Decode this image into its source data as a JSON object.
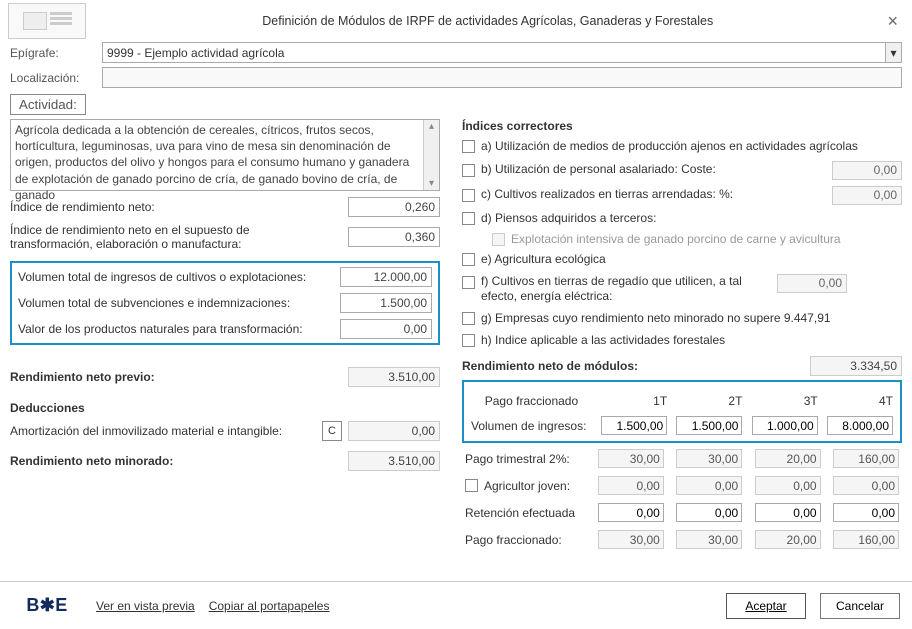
{
  "title": "Definición de Módulos de IRPF de actividades Agrícolas, Ganaderas y Forestales",
  "labels": {
    "epigrafe": "Epígrafe:",
    "localizacion": "Localización:",
    "actividad_btn": "Actividad:"
  },
  "epigrafe_value": "9999 - Ejemplo actividad agrícola",
  "actividad_text": "Agrícola dedicada a la obtención de cereales, cítricos, frutos secos, hortícultura, leguminosas, uva para vino de mesa sin denominación de origen, productos del olivo y hongos para el consumo humano y ganadera de explotación de ganado porcino de cría, de ganado bovino de cría, de ganado",
  "left": {
    "indice_neto_label": "Índice de rendimiento neto:",
    "indice_neto_value": "0,260",
    "indice_transf_label": "Índice de rendimiento neto en el supuesto de transformación, elaboración o manufactura:",
    "indice_transf_value": "0,360",
    "vol_ingresos_label": "Volumen total de ingresos de cultivos o explotaciones:",
    "vol_ingresos_value": "12.000,00",
    "vol_subv_label": "Volumen total de subvenciones e indemnizaciones:",
    "vol_subv_value": "1.500,00",
    "valor_prod_label": "Valor de los productos naturales para transformación:",
    "valor_prod_value": "0,00",
    "rend_previo_label": "Rendimiento neto previo:",
    "rend_previo_value": "3.510,00",
    "deducciones_label": "Deducciones",
    "amort_label": "Amortización del inmovilizado material e intangible:",
    "amort_btn": "C",
    "amort_value": "0,00",
    "rend_minorado_label": "Rendimiento neto minorado:",
    "rend_minorado_value": "3.510,00"
  },
  "right": {
    "indices_head": "Índices correctores",
    "a_label": "a) Utilización de medios de producción ajenos en actividades agrícolas",
    "b_label": "b) Utilización de personal asalariado: Coste:",
    "b_value": "0,00",
    "c_label": "c) Cultivos realizados en tierras arrendadas: %:",
    "c_value": "0,00",
    "d_label": "d) Piensos adquiridos a terceros:",
    "d_sub": "Explotación intensiva de ganado porcino de carne y avicultura",
    "e_label": "e) Agricultura ecológica",
    "f_label": "f) Cultivos en tierras de regadío que utilicen, a tal efecto, energía eléctrica:",
    "f_value": "0,00",
    "g_label": "g) Empresas cuyo rendimiento neto minorado no supere 9.447,91",
    "h_label": "h) Indice aplicable a las actividades forestales",
    "rend_modulos_label": "Rendimiento neto de módulos:",
    "rend_modulos_value": "3.334,50",
    "table": {
      "head_pago": "Pago fraccionado",
      "heads": [
        "1T",
        "2T",
        "3T",
        "4T"
      ],
      "vol_ingresos_label": "Volumen de ingresos:",
      "vol_ingresos": [
        "1.500,00",
        "1.500,00",
        "1.000,00",
        "8.000,00"
      ],
      "pago_trim_label": "Pago trimestral 2%:",
      "pago_trim": [
        "30,00",
        "30,00",
        "20,00",
        "160,00"
      ],
      "agricultor_label": "Agricultor joven:",
      "agricultor": [
        "0,00",
        "0,00",
        "0,00",
        "0,00"
      ],
      "retencion_label": "Retención efectuada",
      "retencion": [
        "0,00",
        "0,00",
        "0,00",
        "0,00"
      ],
      "pago_fracc_label": "Pago fraccionado:",
      "pago_fracc": [
        "30,00",
        "30,00",
        "20,00",
        "160,00"
      ]
    }
  },
  "footer": {
    "logo": "B✱E",
    "preview": "Ver en vista previa",
    "copy": "Copiar al portapapeles",
    "accept": "Aceptar",
    "cancel": "Cancelar"
  }
}
